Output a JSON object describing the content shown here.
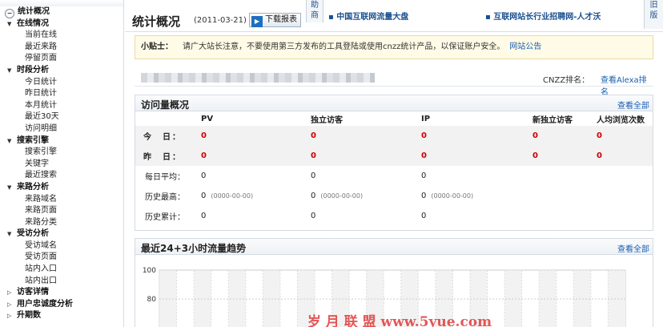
{
  "sidebar": {
    "overview": "统计概况",
    "sections": [
      {
        "label": "在线情况",
        "items": [
          "当前在线",
          "最近来路",
          "停留页面"
        ]
      },
      {
        "label": "时段分析",
        "items": [
          "今日统计",
          "昨日统计",
          "本月统计",
          "最近30天",
          "访问明细"
        ]
      },
      {
        "label": "搜索引擎",
        "items": [
          "搜索引擎",
          "关键字",
          "最近搜索"
        ]
      },
      {
        "label": "来路分析",
        "items": [
          "来路域名",
          "来路页面",
          "来路分类"
        ]
      },
      {
        "label": "受访分析",
        "items": [
          "受访域名",
          "受访页面",
          "站内入口",
          "站内出口"
        ]
      }
    ],
    "collapsed": [
      "访客详情",
      "用户忠诚度分析",
      "升期数"
    ]
  },
  "header": {
    "title": "统计概况",
    "date": "(2011-03-21)",
    "download_label": "下载报表",
    "help_tab": "助 商",
    "news1": "▪ 中国互联网流量大盘",
    "news2": "▪ 互联网站长行业招聘网-人才沃",
    "old_tab": "旧 版"
  },
  "tip": {
    "label": "小贴士：",
    "text": "请广大站长注意，不要使用第三方发布的工具登陆或使用cnzz统计产品，以保证账户安全。",
    "link": "网站公告"
  },
  "site": {
    "rank_label": "CNZZ排名：",
    "rank_link": "查看Alexa排名"
  },
  "overview": {
    "title": "访问量概况",
    "view_all": "查看全部",
    "columns": [
      "PV",
      "独立访客",
      "IP",
      "新独立访客",
      "人均浏览次数"
    ],
    "rows": [
      {
        "label": "今　日：",
        "values": [
          "0",
          "0",
          "0",
          "0",
          "0"
        ]
      },
      {
        "label": "昨　日：",
        "values": [
          "0",
          "0",
          "0",
          "0",
          "0"
        ]
      }
    ],
    "extra_rows": [
      {
        "label": "每日平均：",
        "values": [
          "0",
          "0",
          "0"
        ],
        "notes": [
          "",
          "",
          ""
        ]
      },
      {
        "label": "历史最高：",
        "values": [
          "0",
          "0",
          "0"
        ],
        "notes": [
          "(0000-00-00)",
          "(0000-00-00)",
          "(0000-00-00)"
        ]
      },
      {
        "label": "历史累计：",
        "values": [
          "0",
          "0",
          "0"
        ],
        "notes": [
          "",
          "",
          ""
        ]
      }
    ]
  },
  "trend": {
    "title": "最近24+3小时流量趋势",
    "view_all": "查看全部",
    "watermark": "岁 月 联 盟   www.5yue.com"
  },
  "chart_data": {
    "type": "bar",
    "title": "最近24+3小时流量趋势",
    "xlabel": "",
    "ylabel": "",
    "ylim": [
      0,
      100
    ],
    "yticks": [
      100,
      80
    ],
    "grid": true,
    "categories": [],
    "values": []
  }
}
